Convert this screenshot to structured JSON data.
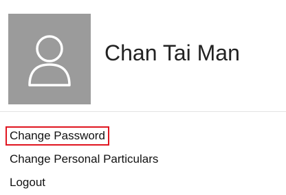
{
  "profile": {
    "avatar_icon": "user-outline-icon",
    "avatar_bg": "#9b9b9b",
    "name": "Chan Tai Man"
  },
  "menu": {
    "items": [
      {
        "label": "Change Password",
        "highlighted": true,
        "highlight_color": "#e0141f"
      },
      {
        "label": "Change Personal Particulars",
        "highlighted": false
      },
      {
        "label": "Logout",
        "highlighted": false
      }
    ]
  }
}
